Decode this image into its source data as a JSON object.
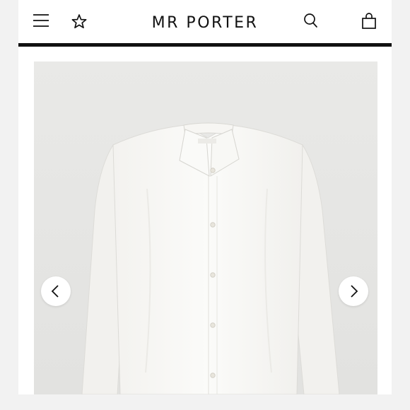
{
  "header": {
    "logo": "MR PORTER",
    "icons": [
      "menu-icon",
      "star-icon",
      "search-icon",
      "shopping-bag-icon"
    ]
  },
  "gallery": {
    "image": "white-long-sleeve-button-shirt",
    "controls": [
      "chevron-left-icon",
      "chevron-right-icon"
    ]
  },
  "colors": {
    "header_rule": "#111111",
    "gallery_background": "#e6e6e4",
    "page_background": "#f2f2f2"
  }
}
